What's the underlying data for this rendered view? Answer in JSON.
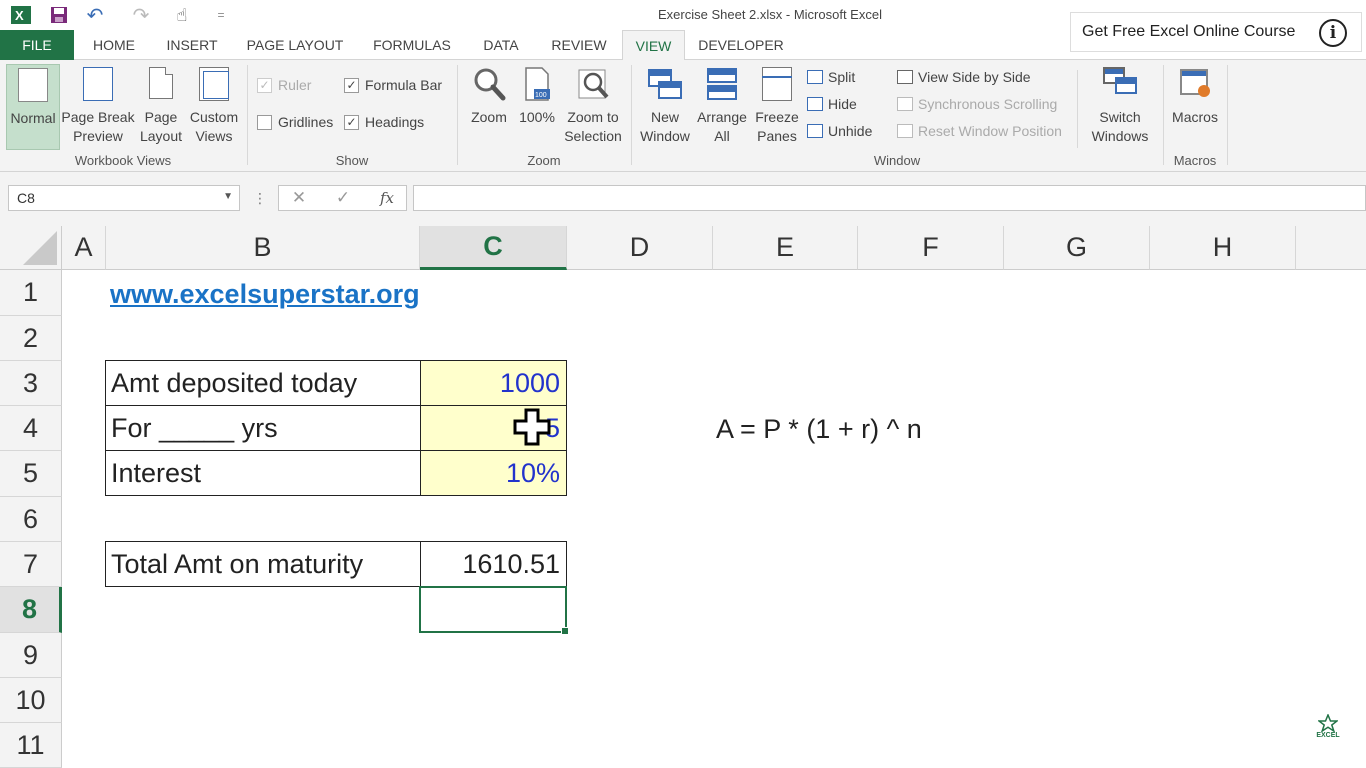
{
  "window": {
    "title": "Exercise Sheet 2.xlsx - Microsoft Excel"
  },
  "promo": {
    "text": "Get Free Excel Online Course",
    "info_symbol": "i"
  },
  "quick_access": {
    "undo_symbol": "↶",
    "redo_symbol": "↷",
    "touch_symbol": "☝",
    "more_symbol": "="
  },
  "tabs": [
    {
      "label": "FILE"
    },
    {
      "label": "HOME"
    },
    {
      "label": "INSERT"
    },
    {
      "label": "PAGE LAYOUT"
    },
    {
      "label": "FORMULAS"
    },
    {
      "label": "DATA"
    },
    {
      "label": "REVIEW"
    },
    {
      "label": "VIEW"
    },
    {
      "label": "DEVELOPER"
    }
  ],
  "ribbon": {
    "workbook_views": {
      "label": "Workbook Views",
      "normal": "Normal",
      "page_break_1": "Page Break",
      "page_break_2": "Preview",
      "page_layout_1": "Page",
      "page_layout_2": "Layout",
      "custom_1": "Custom",
      "custom_2": "Views"
    },
    "show": {
      "label": "Show",
      "ruler": "Ruler",
      "formula_bar": "Formula Bar",
      "gridlines": "Gridlines",
      "headings": "Headings",
      "check_mark": "✓"
    },
    "zoom": {
      "label": "Zoom",
      "zoom": "Zoom",
      "hundred": "100%",
      "zoom_sel_1": "Zoom to",
      "zoom_sel_2": "Selection"
    },
    "window": {
      "label": "Window",
      "new_1": "New",
      "new_2": "Window",
      "arrange_1": "Arrange",
      "arrange_2": "All",
      "freeze_1": "Freeze",
      "freeze_2": "Panes",
      "split": "Split",
      "hide": "Hide",
      "unhide": "Unhide",
      "side_by_side": "View Side by Side",
      "sync_scroll": "Synchronous Scrolling",
      "reset_pos": "Reset Window Position",
      "switch_1": "Switch",
      "switch_2": "Windows"
    },
    "macros": {
      "label": "Macros",
      "macros": "Macros"
    }
  },
  "formula_bar": {
    "name_box": "C8",
    "cancel_symbol": "✕",
    "enter_symbol": "✓",
    "fx_symbol": "fx",
    "formula": ""
  },
  "columns": [
    "A",
    "B",
    "C",
    "D",
    "E",
    "F",
    "G",
    "H"
  ],
  "rows": [
    "1",
    "2",
    "3",
    "4",
    "5",
    "6",
    "7",
    "8",
    "9",
    "10",
    "11"
  ],
  "selected_cell": "C8",
  "cells": {
    "b1": "www.excelsuperstar.org",
    "b3": "Amt deposited today",
    "c3": "1000",
    "b4": "For _____ yrs",
    "c4": "5",
    "b5": "Interest",
    "c5": "10%",
    "b7": "Total Amt on maturity",
    "c7": "1610.51",
    "e4": "A = P * (1 + r) ^ n"
  },
  "colors": {
    "excel_green": "#217346",
    "link_blue": "#1a73c6",
    "input_blue": "#2233cc",
    "input_fill": "#ffffcc"
  }
}
